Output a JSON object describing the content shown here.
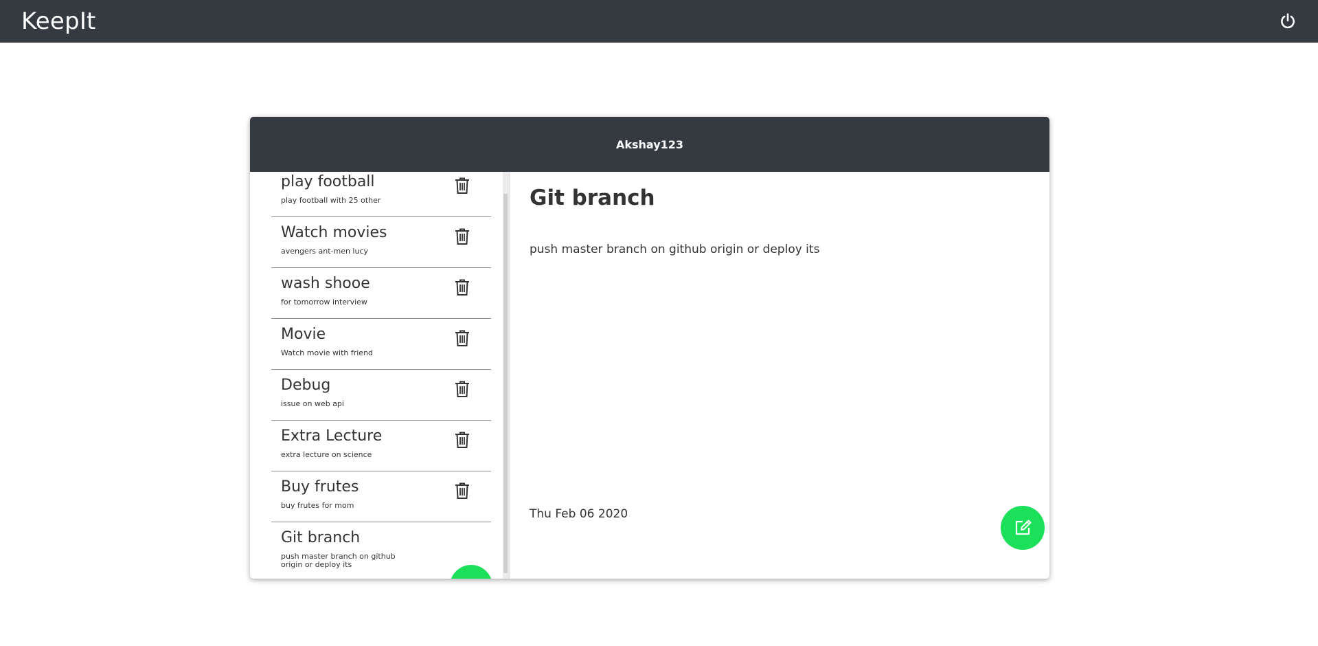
{
  "app": {
    "brand": "KeepIt"
  },
  "header": {
    "power_icon": "power-icon"
  },
  "card": {
    "username": "Akshay123"
  },
  "notes": [
    {
      "title": "play football",
      "description": "play football with 25 other"
    },
    {
      "title": "Watch movies",
      "description": "avengers ant-men lucy"
    },
    {
      "title": "wash shooe",
      "description": "for tomorrow interview"
    },
    {
      "title": "Movie",
      "description": "Watch movie with friend"
    },
    {
      "title": "Debug",
      "description": "issue on web api"
    },
    {
      "title": "Extra Lecture",
      "description": "extra lecture on science"
    },
    {
      "title": "Buy frutes",
      "description": "buy frutes for mom"
    },
    {
      "title": "Git branch",
      "description": "push master branch on github origin or deploy its"
    }
  ],
  "selected_note": {
    "title": "Git branch",
    "description": "push master branch on github origin or deploy its",
    "date": "Thu Feb 06 2020"
  },
  "colors": {
    "topbar": "#343a40",
    "accent_green": "#1de05a"
  },
  "icons": {
    "delete": "trash-icon",
    "add": "plus-icon",
    "edit": "edit-icon",
    "power": "power-icon"
  }
}
